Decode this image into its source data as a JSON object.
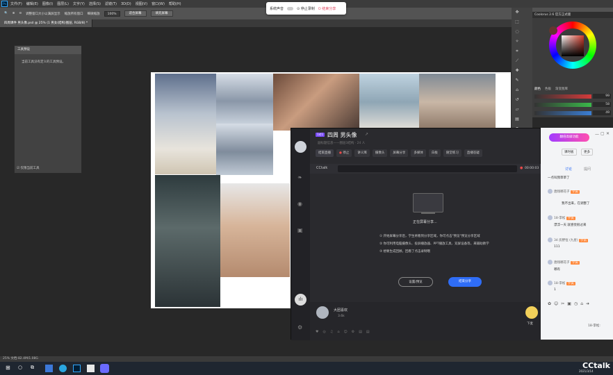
{
  "photoshop": {
    "menu": [
      "文件(F)",
      "编辑(E)",
      "图像(I)",
      "图层(L)",
      "文字(Y)",
      "选择(S)",
      "滤镜(T)",
      "3D(D)",
      "视图(V)",
      "窗口(W)",
      "帮助(H)"
    ],
    "options": {
      "resize_windows": "调整窗口大小以满屏显示",
      "zoom_all": "缩放所有窗口",
      "scrubby_zoom": "细微缩放",
      "zoom_value": "100%",
      "fit_screen": "适合屏幕",
      "fill_screen": "填充屏幕"
    },
    "tabs": [
      "四周课件 男头像.psd @ 25% (1 男女(结构)图层, RGB/8) *"
    ],
    "tool_panel": {
      "title": "工具预设",
      "empty_text": "当前工具没有定义的工具预设。",
      "footer": "仅限当前工具"
    },
    "color_panel": {
      "title": "Coolorus 2.6 官方正式版",
      "tabs": [
        "颜色",
        "色板",
        "渐变图库"
      ],
      "rgb": [
        {
          "label": "R",
          "value": "99",
          "color": "#d43a3a"
        },
        {
          "label": "G",
          "value": "58",
          "color": "#3ab94a"
        },
        {
          "label": "B",
          "value": "49",
          "color": "#3a7ed4"
        }
      ]
    },
    "statusbar": "25%   文档:82.4M/1.08G",
    "taskbar_time": "2021/3/14"
  },
  "share_pill": {
    "system_sound": "系统声音",
    "stop_recording": "停止录制",
    "end_share": "结束分享"
  },
  "cctalk": {
    "badge": "1对1",
    "title": "四周 男头像",
    "subtitle": "副标题信息——图层3结构 · 24 人",
    "toolbar": [
      "结束直播",
      "停止",
      "讲义库",
      "摄像头",
      "屏幕分享",
      "多媒体",
      "白板",
      "随堂练习",
      "直播答疑"
    ],
    "brand": "CCtalk",
    "timer": "00:00:03",
    "sharing_text": "正在屏幕分享...",
    "bullets": [
      "开始屏幕分享后，学生将看到分享区域，你可点击\"预览\"预览分享区域",
      "你可利用电脑摄像头、投屏播放器、PPT播放工具、双屏设备等，来辅助教学",
      "想要生成回顾，回看了点击录制哦"
    ],
    "settings_btn": "设置/预览",
    "end_share_btn": "结束分享",
    "teacher_name": "大团喜欢",
    "teacher_stat": "3.6k",
    "hand_label": "下麦",
    "chat": {
      "promo": "翻倍高级功能",
      "tabs": [
        "讨论",
        "提问"
      ],
      "btn_a": "课时板",
      "btn_b": "更多",
      "messages": [
        {
          "name": "一点叫我草草了",
          "text": ""
        },
        {
          "name": "唐翔哪花子",
          "tag": "学员",
          "text": ""
        },
        {
          "name": "",
          "text": "我不出来，在调整了"
        },
        {
          "name": "18-李松",
          "tag": "学员",
          "text": "漂浮一天 就感觉很过来"
        },
        {
          "name": "34 房野恒 (九星)",
          "tag": "学员",
          "text": "111"
        },
        {
          "name": "唐翔哪花子",
          "tag": "学员",
          "text": "哪有"
        },
        {
          "name": "18-李松",
          "tag": "学员",
          "text": "1"
        }
      ],
      "footer_tag": "18-李松:",
      "watermark": "CCtalk"
    }
  }
}
